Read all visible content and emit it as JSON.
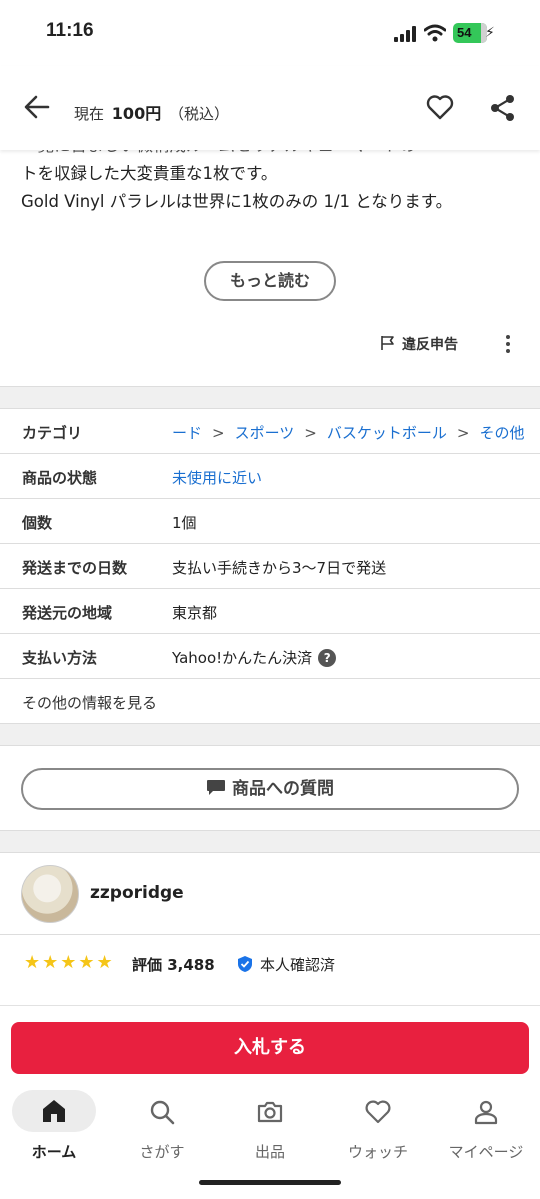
{
  "status_bar": {
    "time": "11:16",
    "battery": "54"
  },
  "header": {
    "price_prefix": "現在",
    "price": "100円",
    "tax": "（税込）"
  },
  "description": {
    "line1": "ー覧に含ましい微構成ルームセリアルキューマートの",
    "line2": "トを収録した大変貴重な1枚です。",
    "line3": "Gold Vinyl パラレルは世界に1枚のみの 1/1 となります。"
  },
  "more_button": "もっと読む",
  "report_label": "違反申告",
  "info": {
    "category_label": "カテゴリ",
    "category_path": [
      "ード",
      "スポーツ",
      "バスケットボール",
      "その他"
    ],
    "condition_label": "商品の状態",
    "condition_value": "未使用に近い",
    "quantity_label": "個数",
    "quantity_value": "1個",
    "shipping_days_label": "発送までの日数",
    "shipping_days_value": "支払い手続きから3〜7日で発送",
    "origin_label": "発送元の地域",
    "origin_value": "東京都",
    "payment_label": "支払い方法",
    "payment_value": "Yahoo!かんたん決済",
    "more_info": "その他の情報を見る"
  },
  "question_button": "商品への質問",
  "seller": {
    "name": "zzporidge",
    "stars": "★★★★★",
    "rating_label": "評価 3,488",
    "verified_label": "本人確認済"
  },
  "bid_button": "入札する",
  "tabs": [
    {
      "label": "ホーム",
      "icon": "home-icon"
    },
    {
      "label": "さがす",
      "icon": "search-icon"
    },
    {
      "label": "出品",
      "icon": "camera-icon"
    },
    {
      "label": "ウォッチ",
      "icon": "heart-icon"
    },
    {
      "label": "マイページ",
      "icon": "person-icon"
    }
  ],
  "colors": {
    "accent_red": "#e8203f",
    "link_blue": "#1a6fd0",
    "star": "#f5c518",
    "verified_blue": "#1a73e8"
  }
}
